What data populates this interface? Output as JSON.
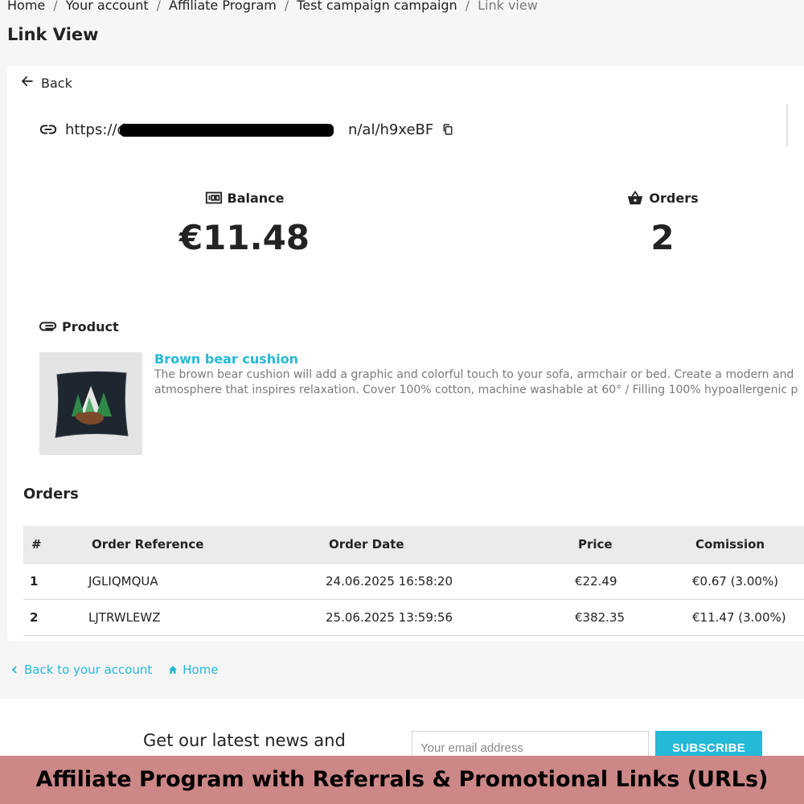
{
  "breadcrumb": {
    "items": [
      "Home",
      "Your account",
      "Affiliate Program",
      "Test campaign campaign"
    ],
    "current": "Link view"
  },
  "page_title": "Link View",
  "back_label": "Back",
  "link": {
    "prefix": "https://d",
    "suffix": "n/al/h9xeBF"
  },
  "stats": {
    "balance_label": "Balance",
    "balance_value": "€11.48",
    "orders_label": "Orders",
    "orders_value": "2"
  },
  "product": {
    "section_label": "Product",
    "name": "Brown bear cushion",
    "description_line1": "The brown bear cushion will add a graphic and colorful touch to your sofa, armchair or bed. Create a modern and",
    "description_line2": "atmosphere that inspires relaxation. Cover 100% cotton, machine washable at 60° / Filling 100% hypoallergenic p"
  },
  "orders": {
    "title": "Orders",
    "columns": [
      "#",
      "Order Reference",
      "Order Date",
      "Price",
      "Comission"
    ],
    "rows": [
      {
        "idx": "1",
        "ref": "JGLIQMQUA",
        "date": "24.06.2025 16:58:20",
        "price": "€22.49",
        "commission": "€0.67 (3.00%)"
      },
      {
        "idx": "2",
        "ref": "LJTRWLEWZ",
        "date": "25.06.2025 13:59:56",
        "price": "€382.35",
        "commission": "€11.47 (3.00%)"
      }
    ]
  },
  "footer_links": {
    "back_to_account": "Back to your account",
    "home": "Home"
  },
  "newsletter": {
    "title": "Get our latest news and",
    "email_placeholder": "Your email address",
    "subscribe_label": "SUBSCRIBE"
  },
  "banner_text": "Affiliate Program with Referrals & Promotional Links (URLs)",
  "colors": {
    "accent": "#24b9d7",
    "banner": "#cd8787",
    "page_bg": "#f6f6f6"
  },
  "icons": {
    "back": "arrow-left-icon",
    "link": "link-icon",
    "copy": "copy-icon",
    "balance": "money-icon",
    "orders": "basket-icon",
    "product": "paperclip-icon",
    "back_to_account": "chevron-left-icon",
    "home": "home-icon"
  }
}
